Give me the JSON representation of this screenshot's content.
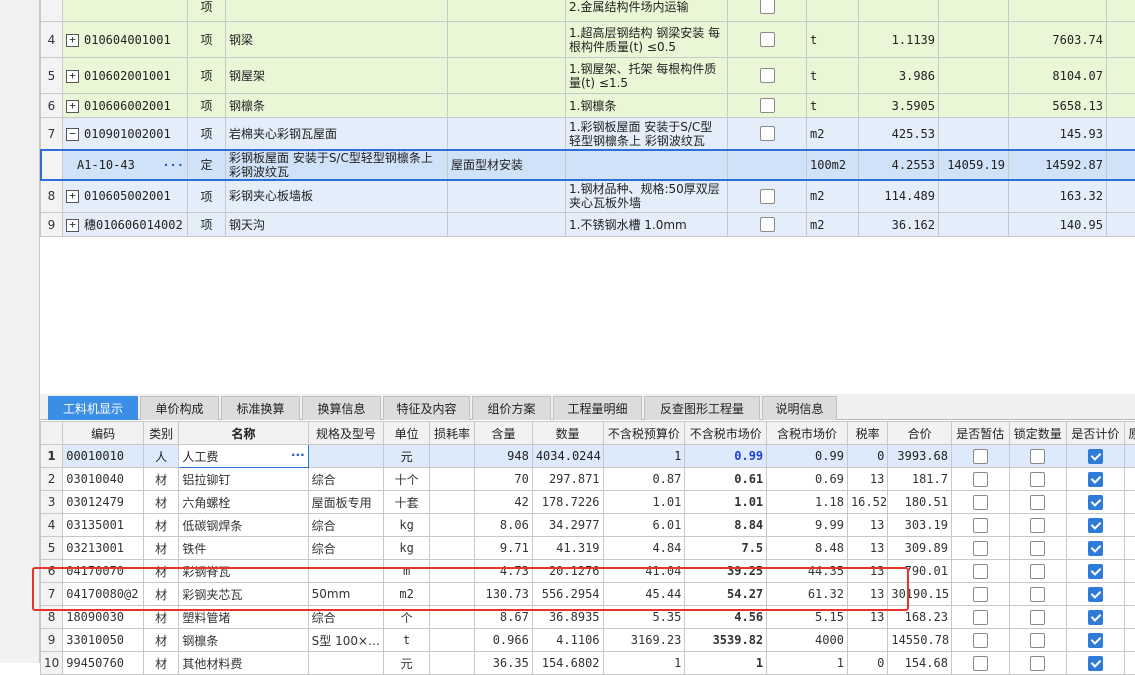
{
  "top_rows": [
    {
      "num": "",
      "code": "",
      "type": "项",
      "name": "",
      "features": "2.金属结构件场内运输",
      "unit": "",
      "qty": "",
      "price": "",
      "total": "",
      "style": "green"
    },
    {
      "num": "4",
      "code": "010604001001",
      "type": "项",
      "name": "钢梁",
      "features": "1.超高层钢结构 钢梁安装 每根构件质量(t) ≤0.5",
      "unit": "t",
      "qty": "1.1139",
      "price": "",
      "total": "7603.74",
      "style": "green"
    },
    {
      "num": "5",
      "code": "010602001001",
      "type": "项",
      "name": "钢屋架",
      "features": "1.钢屋架、托架 每根构件质量(t) ≤1.5",
      "unit": "t",
      "qty": "3.986",
      "price": "",
      "total": "8104.07",
      "style": "green"
    },
    {
      "num": "6",
      "code": "010606002001",
      "type": "项",
      "name": "钢檩条",
      "features": "1.钢檩条",
      "unit": "t",
      "qty": "3.5905",
      "price": "",
      "total": "5658.13",
      "style": "green"
    },
    {
      "num": "7",
      "code": "010901002001",
      "type": "项",
      "name": "岩棉夹心彩钢瓦屋面",
      "features": "1.彩钢板屋面 安装于S/C型轻型钢檩条上 彩钢波纹瓦",
      "unit": "m2",
      "qty": "425.53",
      "price": "",
      "total": "145.93",
      "style": "blue"
    },
    {
      "num": "",
      "code": "A1-10-43",
      "type": "定",
      "name": "彩钢板屋面 安装于S/C型轻型钢檩条上 彩钢波纹瓦",
      "spec": "屋面型材安装",
      "features": "",
      "unit": "100m2",
      "qty": "4.2553",
      "price": "14059.19",
      "total": "14592.87",
      "style": "sel"
    },
    {
      "num": "8",
      "code": "010605002001",
      "type": "项",
      "name": "彩钢夹心板墙板",
      "features": "1.钢材品种、规格:50厚双层夹心瓦板外墙",
      "unit": "m2",
      "qty": "114.489",
      "price": "",
      "total": "163.32",
      "style": "blue"
    },
    {
      "num": "9",
      "code": "穗010606014002",
      "type": "项",
      "name": "钢天沟",
      "features": "1.不锈钢水槽 1.0mm",
      "unit": "m2",
      "qty": "36.162",
      "price": "",
      "total": "140.95",
      "style": "blue"
    }
  ],
  "tabs": [
    "工料机显示",
    "单价构成",
    "标准换算",
    "换算信息",
    "特征及内容",
    "组价方案",
    "工程量明细",
    "反查图形工程量",
    "说明信息"
  ],
  "headers": [
    "编码",
    "类别",
    "名称",
    "规格及型号",
    "单位",
    "损耗率",
    "含量",
    "数量",
    "不含税预算价",
    "不含税市场价",
    "含税市场价",
    "税率",
    "合价",
    "是否暂估",
    "锁定数量",
    "是否计价",
    "原"
  ],
  "rows": [
    {
      "n": "1",
      "code": "00010010",
      "cat": "人",
      "name": "人工费",
      "spec": "",
      "unit": "元",
      "loss": "",
      "content": "948",
      "qty": "4034.0244",
      "pre": "1",
      "mkt": "0.99",
      "taxmkt": "0.99",
      "rate": "0",
      "total": "3993.68",
      "est": false,
      "lock": false,
      "calc": true
    },
    {
      "n": "2",
      "code": "03010040",
      "cat": "材",
      "name": "铝拉铆钉",
      "spec": "综合",
      "unit": "十个",
      "loss": "",
      "content": "70",
      "qty": "297.871",
      "pre": "0.87",
      "mkt": "0.61",
      "taxmkt": "0.69",
      "rate": "13",
      "total": "181.7",
      "est": false,
      "lock": false,
      "calc": true
    },
    {
      "n": "3",
      "code": "03012479",
      "cat": "材",
      "name": "六角螺栓",
      "spec": "屋面板专用",
      "unit": "十套",
      "loss": "",
      "content": "42",
      "qty": "178.7226",
      "pre": "1.01",
      "mkt": "1.01",
      "taxmkt": "1.18",
      "rate": "16.52",
      "total": "180.51",
      "est": false,
      "lock": false,
      "calc": true
    },
    {
      "n": "4",
      "code": "03135001",
      "cat": "材",
      "name": "低碳钢焊条",
      "spec": "综合",
      "unit": "kg",
      "loss": "",
      "content": "8.06",
      "qty": "34.2977",
      "pre": "6.01",
      "mkt": "8.84",
      "taxmkt": "9.99",
      "rate": "13",
      "total": "303.19",
      "est": false,
      "lock": false,
      "calc": true
    },
    {
      "n": "5",
      "code": "03213001",
      "cat": "材",
      "name": "铁件",
      "spec": "综合",
      "unit": "kg",
      "loss": "",
      "content": "9.71",
      "qty": "41.319",
      "pre": "4.84",
      "mkt": "7.5",
      "taxmkt": "8.48",
      "rate": "13",
      "total": "309.89",
      "est": false,
      "lock": false,
      "calc": true
    },
    {
      "n": "6",
      "code": "04170070",
      "cat": "材",
      "name": "彩钢脊瓦",
      "spec": "",
      "unit": "m",
      "loss": "",
      "content": "4.73",
      "qty": "20.1276",
      "pre": "41.04",
      "mkt": "39.25",
      "taxmkt": "44.35",
      "rate": "13",
      "total": "790.01",
      "est": false,
      "lock": false,
      "calc": true
    },
    {
      "n": "7",
      "code": "04170080@2",
      "cat": "材",
      "name": "彩钢夹芯瓦",
      "spec": "50mm",
      "unit": "m2",
      "loss": "",
      "content": "130.73",
      "qty": "556.2954",
      "pre": "45.44",
      "mkt": "54.27",
      "taxmkt": "61.32",
      "rate": "13",
      "total": "30190.15",
      "est": false,
      "lock": false,
      "calc": true
    },
    {
      "n": "8",
      "code": "18090030",
      "cat": "材",
      "name": "塑料管堵",
      "spec": "综合",
      "unit": "个",
      "loss": "",
      "content": "8.67",
      "qty": "36.8935",
      "pre": "5.35",
      "mkt": "4.56",
      "taxmkt": "5.15",
      "rate": "13",
      "total": "168.23",
      "est": false,
      "lock": false,
      "calc": true
    },
    {
      "n": "9",
      "code": "33010050",
      "cat": "材",
      "name": "钢檩条",
      "spec": "S型 100×…",
      "unit": "t",
      "loss": "",
      "content": "0.966",
      "qty": "4.1106",
      "pre": "3169.23",
      "mkt": "3539.82",
      "taxmkt": "4000",
      "total": "14550.78",
      "est": false,
      "lock": false,
      "calc": true
    },
    {
      "n": "10",
      "code": "99450760",
      "cat": "材",
      "name": "其他材料费",
      "spec": "",
      "unit": "元",
      "loss": "",
      "content": "36.35",
      "qty": "154.6802",
      "pre": "1",
      "mkt": "1",
      "taxmkt": "1",
      "rate": "0",
      "total": "154.68",
      "est": false,
      "lock": false,
      "calc": true
    }
  ],
  "edit_dots": "···"
}
